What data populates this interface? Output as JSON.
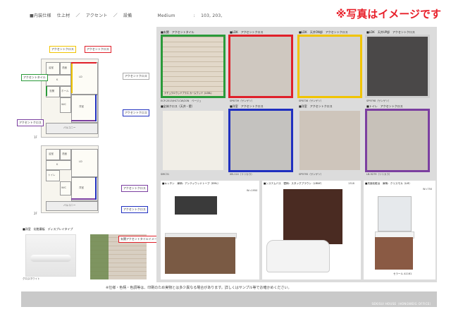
{
  "header": {
    "breadcrumb": [
      "■内装仕様",
      "仕上材",
      "／",
      "アクセント",
      "／",
      "設備"
    ],
    "grade": "Medium",
    "separator": ":",
    "rooms": "103, 203,",
    "note": "※写真はイメージです"
  },
  "floorplans": {
    "floor1_tag": "1F",
    "floor2_tag": "2F",
    "callouts_1f": [
      {
        "text": "アクセントクロス",
        "color": "yellow"
      },
      {
        "text": "アクセントクロス",
        "color": "red"
      },
      {
        "text": "アクセントタイル",
        "color": "green"
      },
      {
        "text": "アクセントクロス",
        "color": "gray"
      },
      {
        "text": "アクセントクロス",
        "color": "blue"
      },
      {
        "text": "アクセントクロス",
        "color": "purple"
      }
    ],
    "callouts_2f": [
      {
        "text": "アクセントクロス",
        "color": "purple"
      },
      {
        "text": "アクセントクロス",
        "color": "blue"
      }
    ],
    "room_labels": [
      "LD",
      "K",
      "洋室",
      "洋室",
      "WIC",
      "玄関",
      "浴室",
      "洗面",
      "トイレ",
      "バルコニー",
      "ホール"
    ]
  },
  "mini_photos": [
    {
      "title": "■洋室　化粧幕板　ディスプレイタイプ",
      "caption": "グロスホワイト"
    },
    {
      "title": "",
      "caption": "玄関アクセントタイルイメージ"
    }
  ],
  "tiles": [
    {
      "title": "■玄関　アクセントタイル",
      "code": "ECP-2515/HCT-CW/20N　ベージュ",
      "inner": "ナチュラルウッドプラス カームウッド（LG6L）"
    },
    {
      "title": "■LDK　アクセントクロス",
      "code": "SP6739（サンゲツ）"
    },
    {
      "title": "■LDK　天井ON部　アクセントクロス",
      "code": "SP6736（サンゲツ）"
    },
    {
      "title": "■LDK　天井UP部　アクセントクロス",
      "code": "SP9798（サンゲツ）"
    },
    {
      "title": "■全体クロス（天井・壁）",
      "code": "SMC31"
    },
    {
      "title": "■洋室　アクセントクロス",
      "code": "XB-114（リリカラ）"
    },
    {
      "title": "■洋室　アクセントクロス",
      "code": "SP9795（サンゲツ）"
    },
    {
      "title": "■トイレ　アクセントクロス",
      "code": "LB-9279（リリカラ）"
    }
  ],
  "equipment": [
    {
      "title": "■キッチン　扉柄：アンティウッドトープ（EML）",
      "size": "W=1950"
    },
    {
      "title": "■システムバス　壁柄：スタッグブラウン（LRNY）",
      "size": "1318"
    },
    {
      "title": "■洗面化粧台　扉柄：クリスモカ（LM）",
      "size": "W=750",
      "caption": "セラール A1161"
    }
  ],
  "footnote": "※仕様・色柄・色調等は、印刷のため実物とは多少異なる場合があります。詳しくはサンプル等でお確かめください。",
  "footer_company": "SEKISUI HOUSE（HONGWEIG OFFICE）",
  "colors": {
    "note_red": "#e8202a",
    "yellow": "#f1c400",
    "red": "#e0202a",
    "green": "#2a9a3a",
    "blue": "#2030c0",
    "purple": "#7b3fa0"
  }
}
